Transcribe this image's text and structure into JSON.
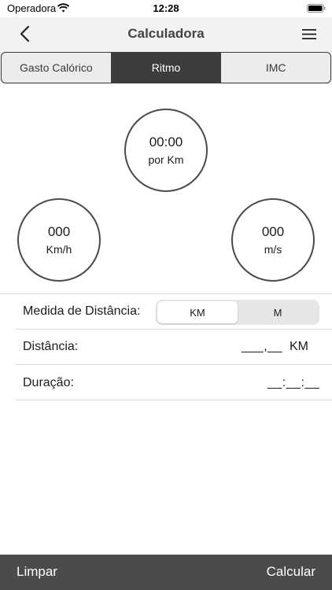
{
  "status_bar": {
    "carrier": "Operadora",
    "time": "12:28",
    "wifi_icon": "wifi-icon",
    "battery_icon": "battery-icon"
  },
  "nav": {
    "title": "Calculadora",
    "back_icon": "chevron-left-icon",
    "menu_icon": "hamburger-menu-icon"
  },
  "tabs": [
    {
      "label": "Gasto Calórico",
      "active": false
    },
    {
      "label": "Ritmo",
      "active": true
    },
    {
      "label": "IMC",
      "active": false
    }
  ],
  "results": {
    "pace": {
      "value": "00:00",
      "unit": "por Km"
    },
    "speed_kmh": {
      "value": "000",
      "unit": "Km/h"
    },
    "speed_ms": {
      "value": "000",
      "unit": "m/s"
    }
  },
  "form": {
    "distance_unit_label": "Medida de Distância:",
    "distance_unit_options": [
      {
        "label": "KM",
        "selected": true
      },
      {
        "label": "M",
        "selected": false
      }
    ],
    "distance_label": "Distância:",
    "distance_placeholder": "___,__",
    "distance_unit": "KM",
    "duration_label": "Duração:",
    "duration_placeholder": "__:__:__"
  },
  "bottom_bar": {
    "clear_label": "Limpar",
    "calculate_label": "Calcular"
  },
  "colors": {
    "nav_background": "#f2f2f2",
    "active_tab": "#3d3d3d",
    "bottom_bar": "#4b4b4b",
    "circle_border": "#4a4a4a"
  }
}
